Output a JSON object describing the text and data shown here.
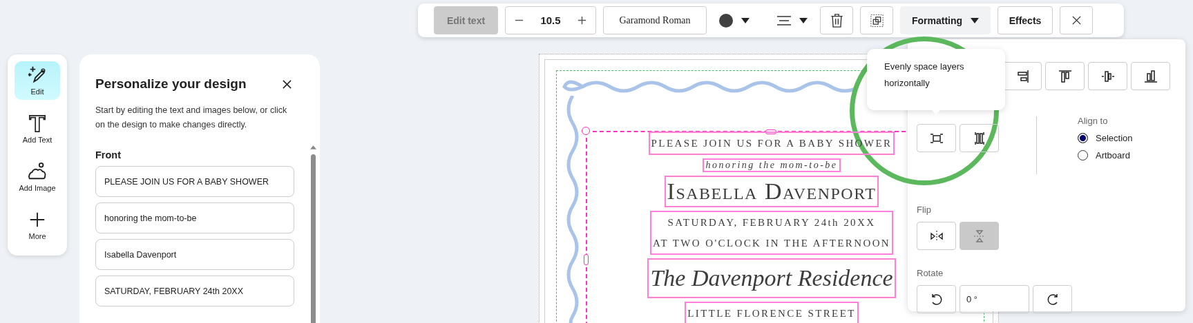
{
  "toolbar": {
    "edit_text": {
      "label": "Edit text",
      "disabled": true
    },
    "font_size": "10.5",
    "font": "Garamond Roman",
    "formatting": "Formatting",
    "effects": "Effects"
  },
  "rail": [
    {
      "kind": "edit",
      "label": "Edit",
      "selected": true
    },
    {
      "kind": "text",
      "label": "Add Text",
      "selected": false
    },
    {
      "kind": "image",
      "label": "Add Image",
      "selected": false
    },
    {
      "kind": "more",
      "label": "More",
      "selected": false
    }
  ],
  "panel": {
    "title": "Personalize your design",
    "intro": "Start by editing the text and images below, or click on the design to make changes directly.",
    "section": "Front",
    "fields": [
      "PLEASE JOIN US FOR A BABY SHOWER",
      "honoring the mom-to-be",
      "Isabella Davenport",
      "SATURDAY, FEBRUARY 24th 20XX"
    ]
  },
  "canvas": {
    "blocks": [
      {
        "kind": "caps",
        "lines": [
          "PLEASE JOIN US FOR A BABY SHOWER"
        ]
      },
      {
        "kind": "italic",
        "lines": [
          "honoring the mom-to-be"
        ]
      },
      {
        "kind": "name",
        "lines": [
          "Isabella Davenport"
        ]
      },
      {
        "kind": "caps",
        "lines": [
          "SATURDAY, FEBRUARY 24th 20XX",
          "AT TWO O'CLOCK IN THE AFTERNOON"
        ]
      },
      {
        "kind": "script",
        "lines": [
          "The Davenport Residence"
        ]
      },
      {
        "kind": "caps",
        "lines": [
          "LITTLE FLORENCE STREET"
        ]
      }
    ]
  },
  "popover": {
    "tooltip": "Evenly space layers horizontally",
    "align_to": "Align to",
    "align_options": [
      {
        "label": "Selection",
        "selected": true
      },
      {
        "label": "Artboard",
        "selected": false
      }
    ],
    "flip": "Flip",
    "flip_buttons": [
      {
        "kind": "horizontal",
        "selected": false
      },
      {
        "kind": "vertical",
        "selected": true
      }
    ],
    "rotate": "Rotate",
    "rotation": "0 °"
  }
}
